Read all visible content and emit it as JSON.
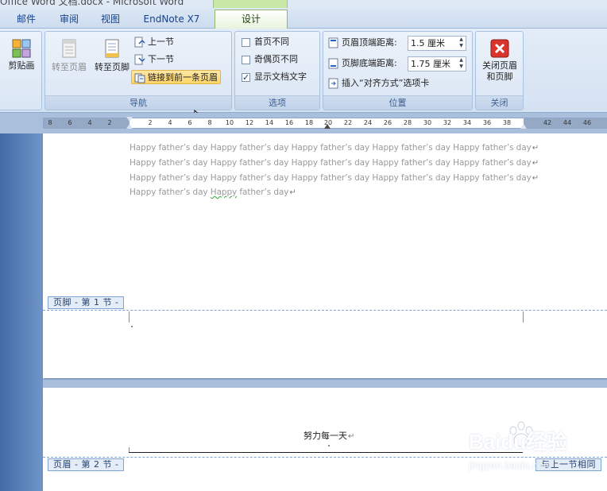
{
  "window": {
    "title": "Office Word 文档.docx - Microsoft Word"
  },
  "tabs": [
    {
      "label": "邮件"
    },
    {
      "label": "审阅"
    },
    {
      "label": "视图"
    },
    {
      "label": "EndNote X7"
    },
    {
      "label": "设计",
      "active": true
    }
  ],
  "ribbon": {
    "clipart": {
      "label": "剪贴画"
    },
    "navigation": {
      "group_label": "导航",
      "goto_header": "转至页眉",
      "goto_footer": "转至页脚",
      "previous_section": "上一节",
      "next_section": "下一节",
      "link_to_previous": "链接到前一条页眉"
    },
    "options": {
      "group_label": "选项",
      "different_first_page": {
        "label": "首页不同",
        "checked": false
      },
      "different_odd_even": {
        "label": "奇偶页不同",
        "checked": false
      },
      "show_document_text": {
        "label": "显示文档文字",
        "checked": true
      }
    },
    "position": {
      "group_label": "位置",
      "header_from_top_label": "页眉顶端距离:",
      "header_from_top_value": "1.5 厘米",
      "footer_from_bottom_label": "页脚底端距离:",
      "footer_from_bottom_value": "1.75 厘米",
      "insert_alignment_tab": "插入“对齐方式”选项卡"
    },
    "close": {
      "group_label": "关闭",
      "close_button_line1": "关闭页眉",
      "close_button_line2": "和页脚"
    }
  },
  "ruler": {
    "numbers": [
      "8",
      "6",
      "4",
      "2",
      "2",
      "4",
      "6",
      "8",
      "10",
      "12",
      "14",
      "16",
      "18",
      "20",
      "22",
      "24",
      "26",
      "28",
      "30",
      "32",
      "34",
      "36",
      "38",
      "42",
      "44",
      "46"
    ]
  },
  "document": {
    "body_lines": [
      "Happy father’s day Happy father’s day Happy father’s day Happy father’s day Happy father’s day",
      "Happy father’s day Happy father’s day Happy father’s day Happy father’s day Happy father’s day",
      "Happy father’s day Happy father’s day Happy father’s day Happy father’s day Happy father’s day"
    ],
    "last_line_prefix": "Happy father’s day ",
    "last_line_wavy": "Happy",
    "last_line_suffix": " father’s day",
    "paragraph_mark": "↵",
    "footer_label": "页脚 - 第 1 节 -",
    "header_label": "页眉 - 第 2 节 -",
    "same_as_previous": "与上一节相同",
    "header_text": "努力每一天",
    "header_para_mark": "↵"
  },
  "watermark": {
    "brand": "Baidu经验",
    "url": "jingyan.baidu.com"
  },
  "colors": {
    "ribbon": "#dae6f5",
    "context_tab": "#c8e8a8",
    "dashed_border": "#7ea4d4",
    "close_icon": "#d9352c"
  }
}
